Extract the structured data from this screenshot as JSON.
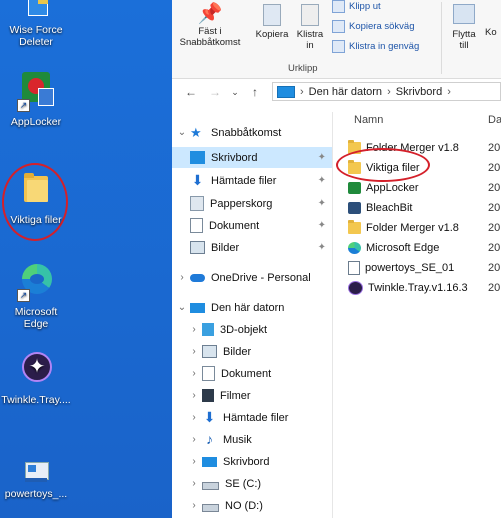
{
  "desktop": {
    "icons": [
      {
        "label_line1": "Wise Force",
        "label_line2": "Deleter"
      },
      {
        "label_line1": "AppLocker",
        "label_line2": ""
      },
      {
        "label_line1": "Viktiga filer",
        "label_line2": ""
      },
      {
        "label_line1": "Microsoft",
        "label_line2": "Edge"
      },
      {
        "label_line1": "Twinkle.Tray....",
        "label_line2": ""
      },
      {
        "label_line1": "powertoys_...",
        "label_line2": ""
      }
    ]
  },
  "ribbon": {
    "pin_label_line1": "Fäst i",
    "pin_label_line2": "Snabbåtkomst",
    "copy_label": "Kopiera",
    "paste_label_line1": "Klistra",
    "paste_label_line2": "in",
    "cut_label": "Klipp ut",
    "copy_path_label": "Kopiera sökväg",
    "paste_shortcut_label": "Klistra in genväg",
    "move_label_line1": "Flytta",
    "move_label_line2": "till",
    "copyto_label": "Ko",
    "group_label": "Urklipp"
  },
  "address": {
    "crumbs": [
      "Den här datorn",
      "Skrivbord"
    ]
  },
  "nav": {
    "quick_access": "Snabbåtkomst",
    "quick_items": [
      "Skrivbord",
      "Hämtade filer",
      "Papperskorg",
      "Dokument",
      "Bilder"
    ],
    "onedrive": "OneDrive - Personal",
    "this_pc": "Den här datorn",
    "pc_items": [
      "3D-objekt",
      "Bilder",
      "Dokument",
      "Filmer",
      "Hämtade filer",
      "Musik",
      "Skrivbord",
      "SE (C:)",
      "NO (D:)"
    ]
  },
  "files": {
    "col_name": "Namn",
    "col_date": "Da",
    "rows": [
      {
        "name": "Folder Merger v1.8",
        "date": "20"
      },
      {
        "name": "Viktiga filer",
        "date": "20"
      },
      {
        "name": "AppLocker",
        "date": "20"
      },
      {
        "name": "BleachBit",
        "date": "20"
      },
      {
        "name": "Folder Merger v1.8",
        "date": "20"
      },
      {
        "name": "Microsoft Edge",
        "date": "20"
      },
      {
        "name": "powertoys_SE_01",
        "date": "20"
      },
      {
        "name": "Twinkle.Tray.v1.16.3",
        "date": "20"
      }
    ]
  },
  "colors": {
    "desktop_bg": "#1b6fd9",
    "selection": "#cce8ff",
    "annotation": "#d4202a"
  }
}
